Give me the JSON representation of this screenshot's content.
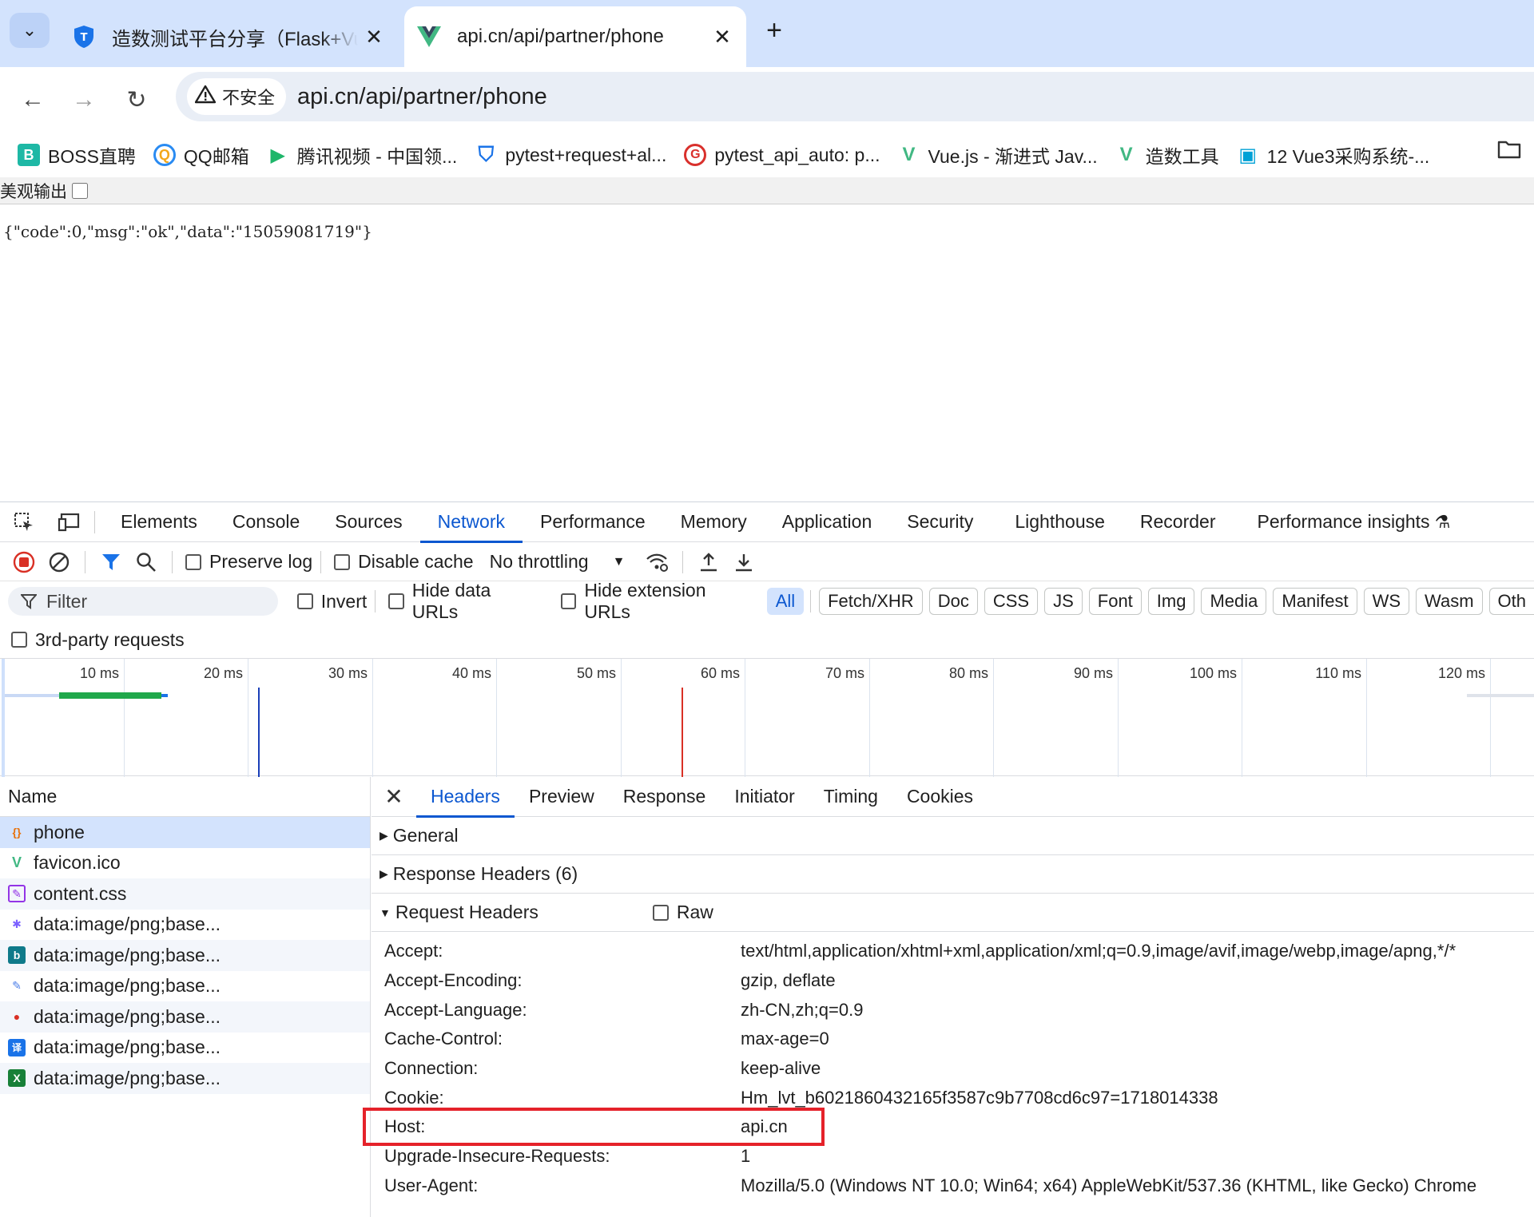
{
  "tabs": [
    {
      "title": "造数测试平台分享（Flask+Vue",
      "active": false
    },
    {
      "title": "api.cn/api/partner/phone",
      "active": true
    }
  ],
  "address_bar": {
    "security_label": "不安全",
    "url": "api.cn/api/partner/phone"
  },
  "bookmarks": [
    {
      "label": "BOSS直聘",
      "icon_text": "B",
      "color": "#1eb8a5"
    },
    {
      "label": "QQ邮箱",
      "icon_text": "Q",
      "color": "#f3a81b"
    },
    {
      "label": "腾讯视频 - 中国领...",
      "icon_text": "▶",
      "color": "#1fb66a"
    },
    {
      "label": "pytest+request+al...",
      "icon_text": "⛉",
      "color": "#1a73e8"
    },
    {
      "label": "pytest_api_auto: p...",
      "icon_text": "G",
      "color": "#d9302c"
    },
    {
      "label": "Vue.js - 渐进式 Jav...",
      "icon_text": "V",
      "color": "#41b883"
    },
    {
      "label": "造数工具",
      "icon_text": "V",
      "color": "#41b883"
    },
    {
      "label": "12 Vue3采购系统-...",
      "icon_text": "▣",
      "color": "#00a1d6"
    }
  ],
  "page": {
    "pretty_print_label": "美观输出",
    "json_text": "{\"code\":0,\"msg\":\"ok\",\"data\":\"15059081719\"}"
  },
  "devtools": {
    "panels": [
      "Elements",
      "Console",
      "Sources",
      "Network",
      "Performance",
      "Memory",
      "Application",
      "Security",
      "Lighthouse",
      "Recorder",
      "Performance insights"
    ],
    "active_panel": "Network",
    "toolbar": {
      "preserve_log": "Preserve log",
      "disable_cache": "Disable cache",
      "throttling": "No throttling"
    },
    "filter": {
      "placeholder": "Filter",
      "invert": "Invert",
      "hide_data_urls": "Hide data URLs",
      "hide_extension_urls": "Hide extension URLs",
      "types": [
        "All",
        "Fetch/XHR",
        "Doc",
        "CSS",
        "JS",
        "Font",
        "Img",
        "Media",
        "Manifest",
        "WS",
        "Wasm",
        "Oth"
      ],
      "active_type": "All",
      "third_party": "3rd-party requests"
    },
    "timeline_ticks": [
      "10 ms",
      "20 ms",
      "30 ms",
      "40 ms",
      "50 ms",
      "60 ms",
      "70 ms",
      "80 ms",
      "90 ms",
      "100 ms",
      "110 ms",
      "120 ms"
    ],
    "name_header": "Name",
    "requests": [
      {
        "name": "phone",
        "icon_text": "{}",
        "color": "#e8710a"
      },
      {
        "name": "favicon.ico",
        "icon_text": "V",
        "color": "#41b883"
      },
      {
        "name": "content.css",
        "icon_text": "✎",
        "color": "#9334e6"
      },
      {
        "name": "data:image/png;base...",
        "icon_text": "✱",
        "color": "#7b61ff"
      },
      {
        "name": "data:image/png;base...",
        "icon_text": "b",
        "color": "#0f7a8a"
      },
      {
        "name": "data:image/png;base...",
        "icon_text": "✎",
        "color": "#4a7de8"
      },
      {
        "name": "data:image/png;base...",
        "icon_text": "●",
        "color": "#d93025"
      },
      {
        "name": "data:image/png;base...",
        "icon_text": "译",
        "color": "#1a73e8"
      },
      {
        "name": "data:image/png;base...",
        "icon_text": "X",
        "color": "#188038"
      }
    ],
    "detail_tabs": [
      "Headers",
      "Preview",
      "Response",
      "Initiator",
      "Timing",
      "Cookies"
    ],
    "active_detail_tab": "Headers",
    "sections": {
      "general": "General",
      "response_headers": "Response Headers (6)",
      "request_headers": "Request Headers",
      "raw": "Raw"
    },
    "request_headers": [
      {
        "name": "Accept:",
        "value": "text/html,application/xhtml+xml,application/xml;q=0.9,image/avif,image/webp,image/apng,*/*"
      },
      {
        "name": "Accept-Encoding:",
        "value": "gzip, deflate"
      },
      {
        "name": "Accept-Language:",
        "value": "zh-CN,zh;q=0.9"
      },
      {
        "name": "Cache-Control:",
        "value": "max-age=0"
      },
      {
        "name": "Connection:",
        "value": "keep-alive"
      },
      {
        "name": "Cookie:",
        "value": "Hm_lvt_b6021860432165f3587c9b7708cd6c97=1718014338"
      },
      {
        "name": "Host:",
        "value": "api.cn"
      },
      {
        "name": "Upgrade-Insecure-Requests:",
        "value": "1"
      },
      {
        "name": "User-Agent:",
        "value": "Mozilla/5.0 (Windows NT 10.0; Win64; x64) AppleWebKit/537.36 (KHTML, like Gecko) Chrome"
      }
    ]
  }
}
